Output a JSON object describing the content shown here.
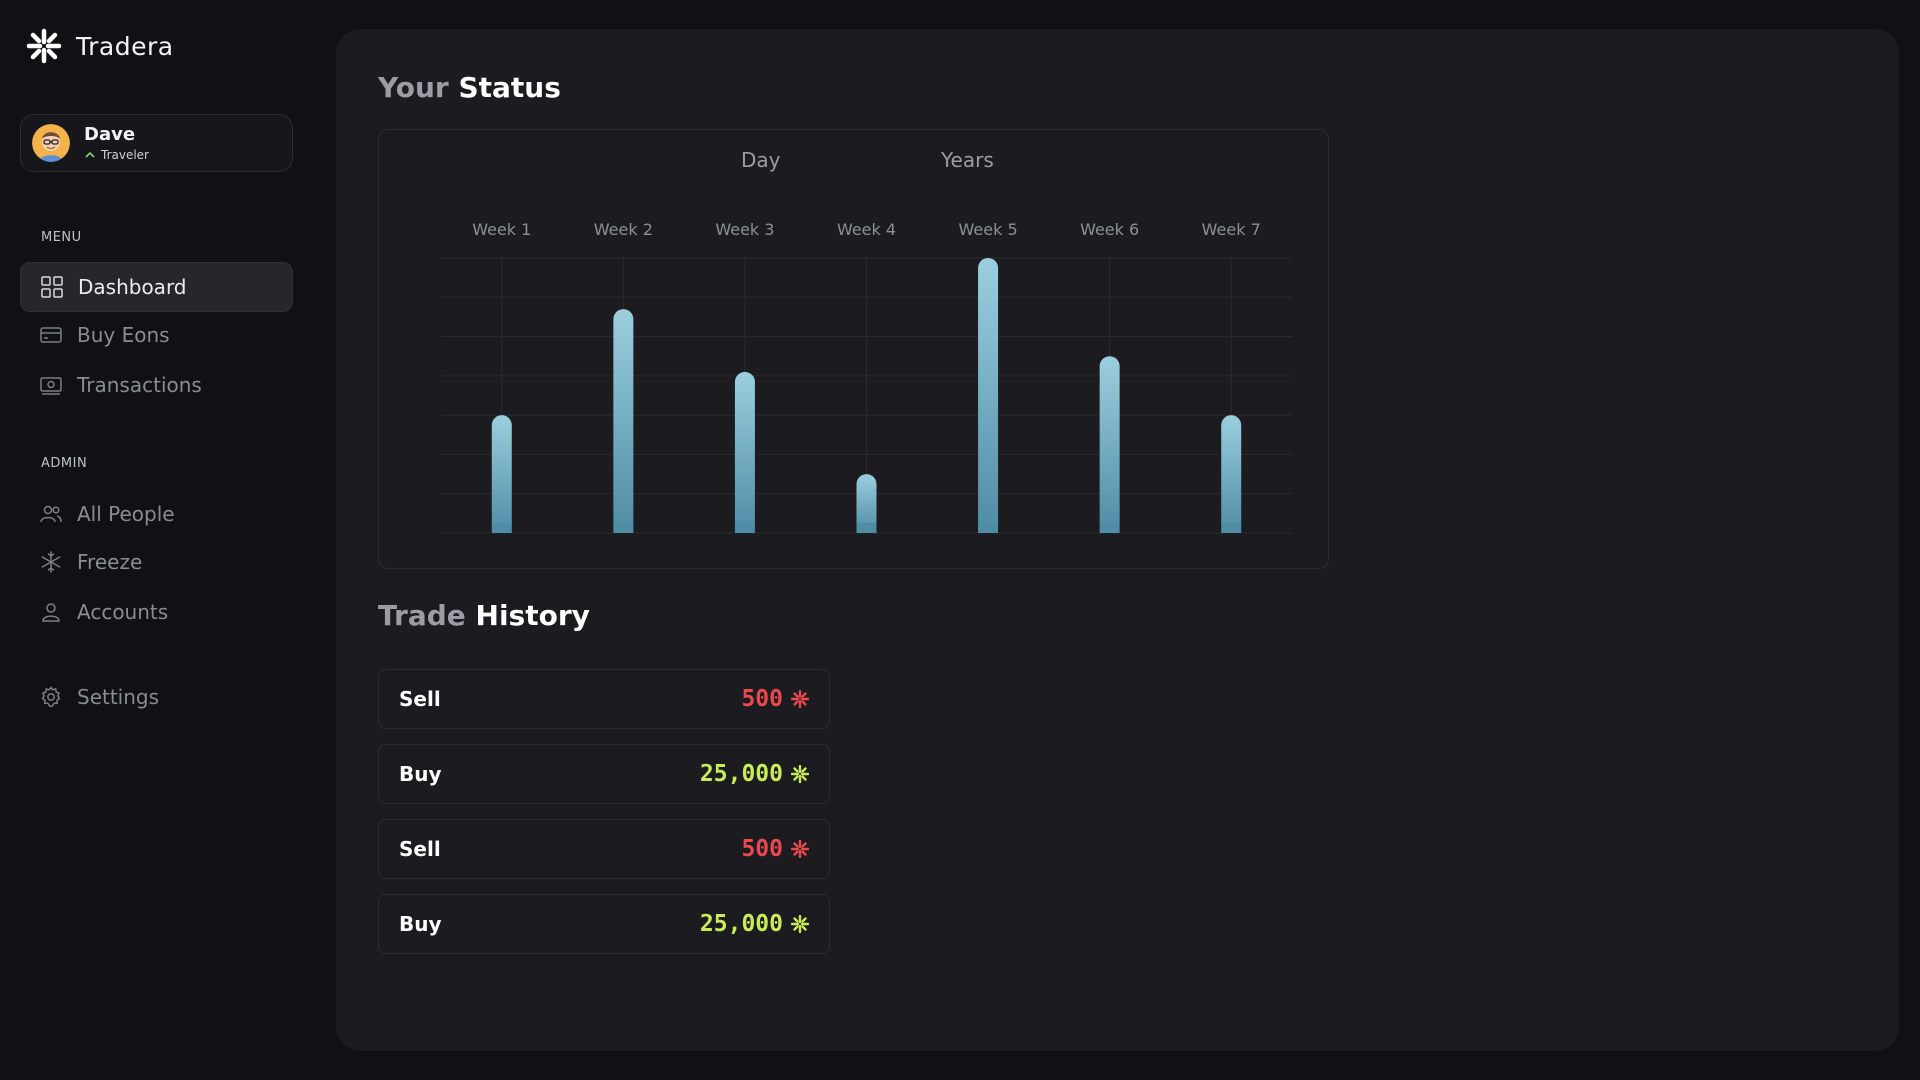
{
  "app": {
    "name": "Tradera"
  },
  "user": {
    "name": "Dave",
    "role": "Traveler"
  },
  "sidebar": {
    "menu_label": "MENU",
    "admin_label": "ADMIN",
    "menu_items": [
      {
        "label": "Dashboard",
        "icon": "grid-icon",
        "active": true
      },
      {
        "label": "Buy Eons",
        "icon": "card-icon"
      },
      {
        "label": "Transactions",
        "icon": "cash-icon"
      }
    ],
    "admin_items": [
      {
        "label": "All People",
        "icon": "people-icon"
      },
      {
        "label": "Freeze",
        "icon": "snowflake-icon"
      },
      {
        "label": "Accounts",
        "icon": "user-icon"
      }
    ],
    "settings": {
      "label": "Settings",
      "icon": "gear-icon"
    }
  },
  "status": {
    "title_light": "Your",
    "title_bold": "Status",
    "range_tabs": [
      "Day",
      "Years"
    ]
  },
  "chart_data": {
    "type": "bar",
    "categories": [
      "Week 1",
      "Week 2",
      "Week 3",
      "Week 4",
      "Week 5",
      "Week 6",
      "Week 7"
    ],
    "values": [
      30,
      57,
      41,
      15,
      70,
      45,
      30
    ],
    "ylim": [
      0,
      70
    ],
    "grid": true,
    "bar_gradient": [
      "#9bcfde",
      "#4f8ca6"
    ]
  },
  "history": {
    "title_light": "Trade",
    "title_bold": "History",
    "trades": [
      {
        "type": "Sell",
        "amount": "500",
        "color": "#e9484e"
      },
      {
        "type": "Buy",
        "amount": "25,000",
        "color": "#c9eb5a"
      },
      {
        "type": "Sell",
        "amount": "500",
        "color": "#e9484e"
      },
      {
        "type": "Buy",
        "amount": "25,000",
        "color": "#c9eb5a"
      }
    ]
  }
}
